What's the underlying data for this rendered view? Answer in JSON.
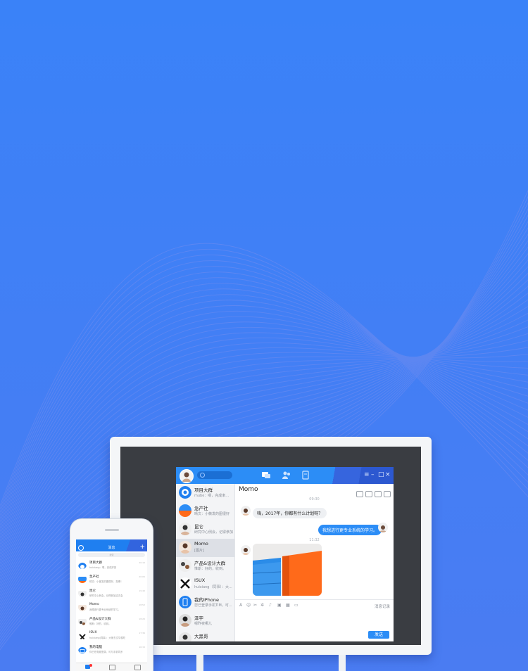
{
  "desktop": {
    "my_avatar": "user-avatar",
    "nav_icons": [
      "chat-icon",
      "contacts-icon",
      "files-icon"
    ],
    "window_controls": [
      "≡",
      "–",
      "□",
      "×"
    ],
    "conversations": [
      {
        "name": "项目大群",
        "preview": "mube：嗯，完成率...",
        "icon": "group-icon"
      },
      {
        "name": "急产社",
        "preview": "晴文：小薇发的图很好",
        "icon": "group-icon"
      },
      {
        "name": "昆仑",
        "preview": "研究中心例会，记得参加",
        "icon": "user-avatar"
      },
      {
        "name": "Momo",
        "preview": "[图片]",
        "icon": "user-avatar"
      },
      {
        "name": "产品&设计大群",
        "preview": "惟斯：好的，收到。",
        "icon": "group-icon"
      },
      {
        "name": "ISUX",
        "preview": "huixiang（同事）：大...",
        "icon": "isux-logo"
      },
      {
        "name": "我的iPhone",
        "preview": "您已登录手机TIM，可...",
        "icon": "phone-icon"
      },
      {
        "name": "泽宇",
        "preview": "嗯昨夜哪儿",
        "icon": "user-avatar"
      },
      {
        "name": "大黑哥",
        "preview": "",
        "icon": "user-avatar"
      }
    ],
    "chat": {
      "title": "Momo",
      "time1": "09:30",
      "msg_in": "嗨，2017年，你都有什么计划呀？",
      "msg_out": "我想进行更专业系统的学习。",
      "time2": "11:32",
      "image_message": "image-message",
      "history_label": "消息记录",
      "send_label": "发送"
    }
  },
  "phone": {
    "title": "消息",
    "search_placeholder": "搜索",
    "conversations": [
      {
        "name": "项目大群",
        "preview": "huixiang：嗯，完成好的",
        "time": "20:16"
      },
      {
        "name": "急产社",
        "preview": "晴文：小薇发的图很好，真棒！",
        "time": "20:05"
      },
      {
        "name": "昆仑",
        "preview": "研究中心例会，记得参加这次会",
        "time": "19:40"
      },
      {
        "name": "Momo",
        "preview": "我想进行更专业系统的学习。",
        "time": "18:52"
      },
      {
        "name": "产品&设计大群",
        "preview": "惟斯：好的，收到。",
        "time": "18:20"
      },
      {
        "name": "ISUX",
        "preview": "huixiang(同事)：大家去文华楼吃",
        "time": "17:36"
      },
      {
        "name": "我的电脑",
        "preview": "你已在电脑登录，可与手机同步",
        "time": "16:15"
      }
    ],
    "tab_badge": "3",
    "colors": {
      "accent": "#1f7ff0",
      "background": "#3f7ff7"
    }
  }
}
